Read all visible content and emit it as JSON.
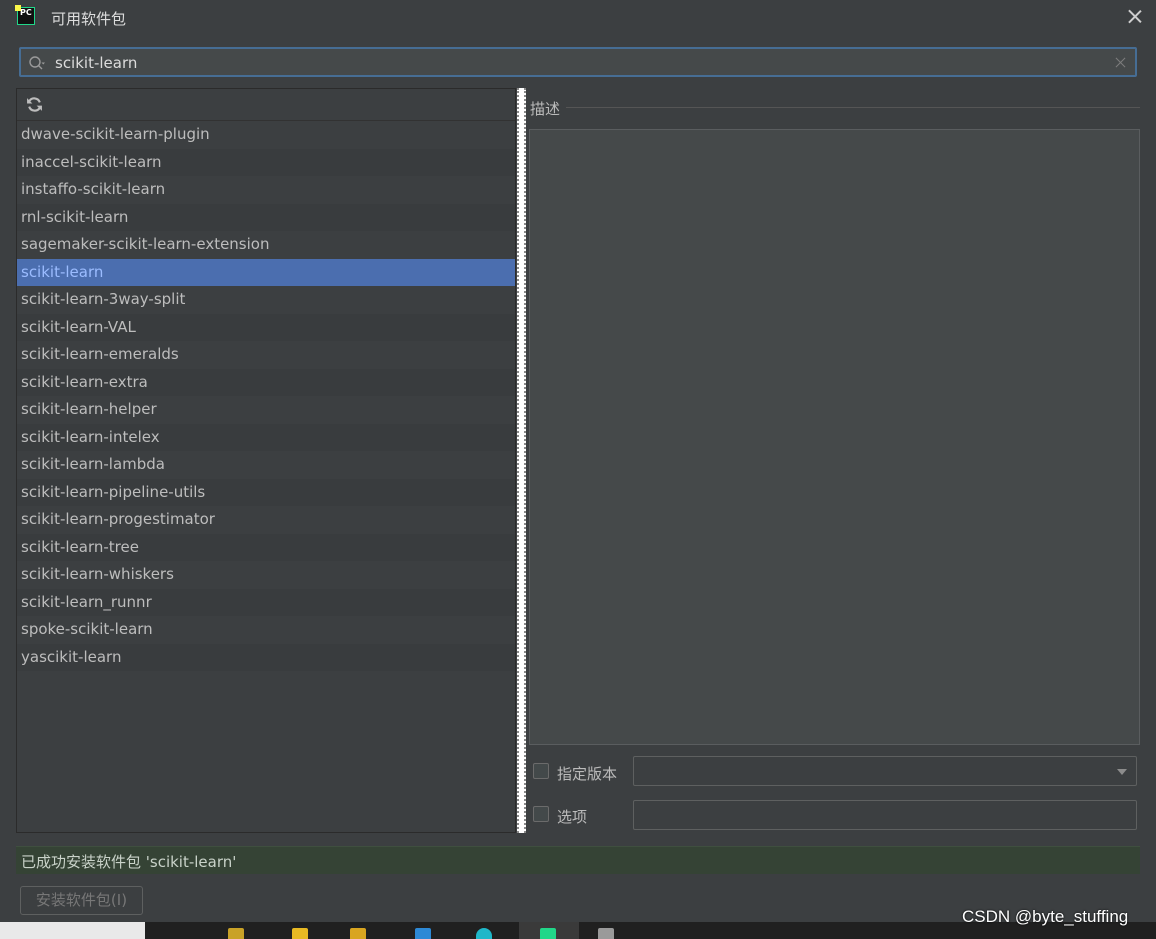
{
  "window": {
    "title": "可用软件包",
    "logo_text": "PC"
  },
  "search": {
    "value": "scikit-learn",
    "placeholder": ""
  },
  "packages": [
    "dwave-scikit-learn-plugin",
    "inaccel-scikit-learn",
    "instaffo-scikit-learn",
    "rnl-scikit-learn",
    "sagemaker-scikit-learn-extension",
    "scikit-learn",
    "scikit-learn-3way-split",
    "scikit-learn-VAL",
    "scikit-learn-emeralds",
    "scikit-learn-extra",
    "scikit-learn-helper",
    "scikit-learn-intelex",
    "scikit-learn-lambda",
    "scikit-learn-pipeline-utils",
    "scikit-learn-progestimator",
    "scikit-learn-tree",
    "scikit-learn-whiskers",
    "scikit-learn_runnr",
    "spoke-scikit-learn",
    "yascikit-learn"
  ],
  "selected_package": "scikit-learn",
  "description": {
    "label": "描述",
    "content": ""
  },
  "specify_version": {
    "label": "指定版本",
    "checked": false,
    "value": ""
  },
  "options": {
    "label": "选项",
    "checked": false,
    "value": ""
  },
  "status": {
    "text": "已成功安装软件包 'scikit-learn'",
    "color": "#354335"
  },
  "install_button": {
    "label": "安装软件包(I)",
    "enabled": false
  },
  "colors": {
    "selection": "#4b6eaf",
    "accent_border": "#466d94"
  },
  "watermark": "CSDN @byte_stuffing"
}
